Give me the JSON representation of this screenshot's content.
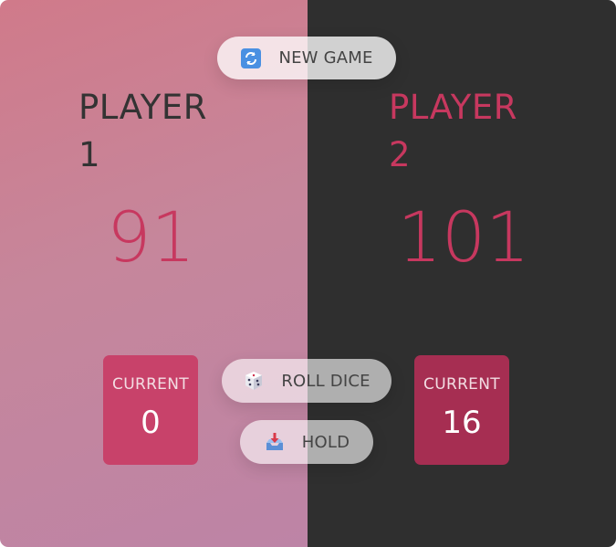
{
  "players": [
    {
      "name_line1": "PLAYER",
      "name_line2": "1",
      "score": "91",
      "current_label": "CURRENT",
      "current_score": "0",
      "active": true
    },
    {
      "name_line1": "PLAYER",
      "name_line2": "2",
      "score": "101",
      "current_label": "CURRENT",
      "current_score": "16",
      "active": false
    }
  ],
  "buttons": {
    "new_game": {
      "label": "NEW GAME",
      "icon": "refresh-icon"
    },
    "roll_dice": {
      "label": "ROLL DICE",
      "icon": "dice-icon"
    },
    "hold": {
      "label": "HOLD",
      "icon": "inbox-tray-icon"
    }
  },
  "colors": {
    "accent": "#c7385f",
    "active_panel": "#c6869b",
    "inactive_panel": "#2f2f2f",
    "current_box_active": "#c8426a",
    "current_box_inactive": "#a62e52"
  }
}
